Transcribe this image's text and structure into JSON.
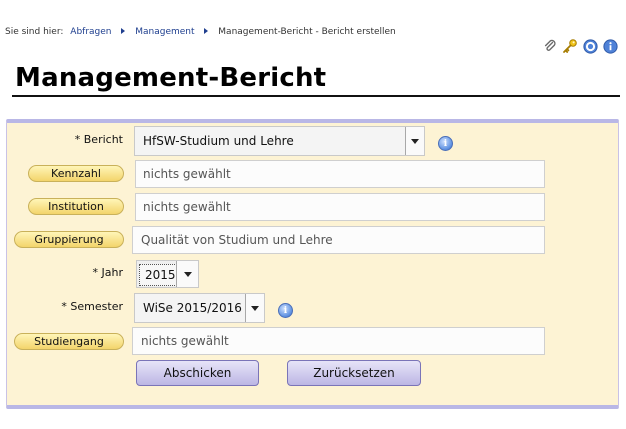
{
  "breadcrumb": {
    "prefix": "Sie sind hier:",
    "items": [
      "Abfragen",
      "Management"
    ],
    "current": "Management-Bericht - Bericht erstellen"
  },
  "toolbar": {
    "icons": [
      "paperclip-icon",
      "key-icon",
      "help-icon",
      "info-icon"
    ]
  },
  "page": {
    "title": "Management-Bericht"
  },
  "form": {
    "bericht": {
      "label": "* Bericht",
      "value": "HfSW-Studium und Lehre"
    },
    "kennzahl": {
      "button": "Kennzahl",
      "value": "nichts gewählt"
    },
    "institution": {
      "button": "Institution",
      "value": "nichts gewählt"
    },
    "gruppierung": {
      "button": "Gruppierung",
      "value": "Qualität von Studium und Lehre"
    },
    "jahr": {
      "label": "* Jahr",
      "value": "2015"
    },
    "semester": {
      "label": "* Semester",
      "value": "WiSe 2015/2016"
    },
    "studiengang": {
      "button": "Studiengang",
      "value": "nichts gewählt"
    },
    "submit": "Abschicken",
    "reset": "Zurücksetzen"
  },
  "colors": {
    "panel_bg": "#fdf3d4",
    "panel_border": "#b9b7e6",
    "pill_button": "#f3d46b",
    "action_button": "#bcb6e4",
    "link": "#1f3f8f"
  }
}
